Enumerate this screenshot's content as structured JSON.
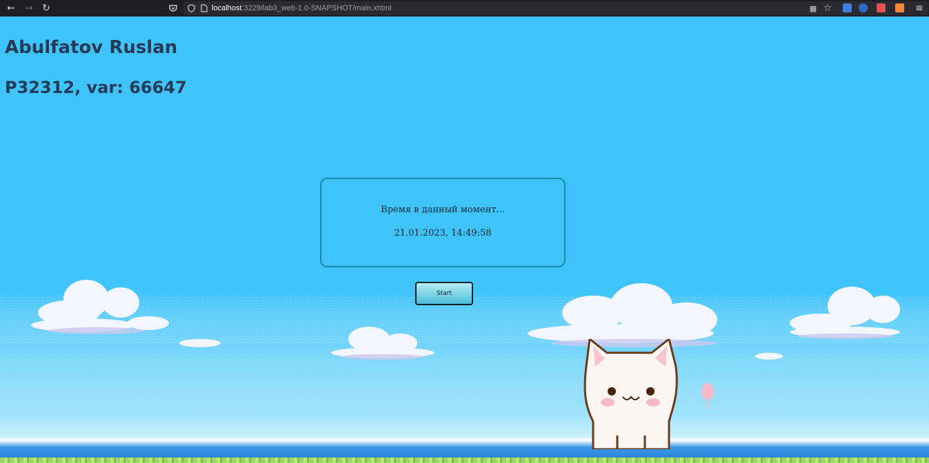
{
  "browser": {
    "url_host": "localhost",
    "url_path": ":3229/lab3_web-1.0-SNAPSHOT/main.xhtml",
    "icons": [
      "back-icon",
      "forward-icon",
      "reload-icon",
      "pocket-icon",
      "shield-icon",
      "page-icon",
      "translate-icon",
      "star-icon",
      "menu-icon"
    ]
  },
  "page": {
    "name": "Abulfatov Ruslan",
    "group": "P32312, var: 66647",
    "clock": {
      "title": "Время в данный момент...",
      "time": "21.01.2023, 14:49:58"
    },
    "start_label": "Start"
  },
  "colors": {
    "sky": "#3ec4fb",
    "heading": "#243a56",
    "box_border": "#1a8aa6"
  }
}
